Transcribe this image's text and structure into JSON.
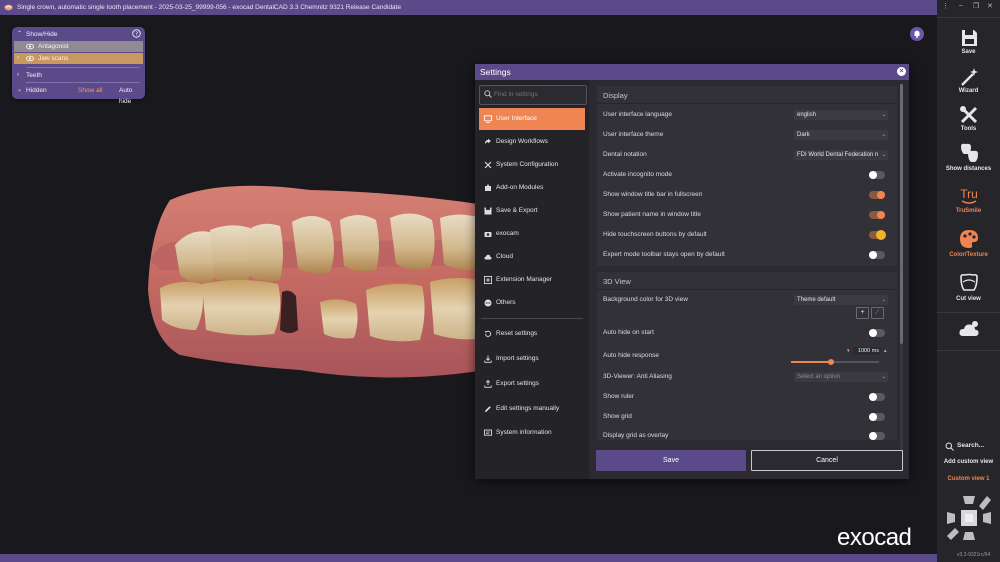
{
  "window": {
    "title": "Single crown, automatic single tooth placement - 2025-03-25_99999-056 - exocad DentalCAD 3.3 Chemnitz 9321 Release Candidate"
  },
  "show_hide": {
    "header": "Show/Hide",
    "items": [
      {
        "label": "Antagonist"
      },
      {
        "label": "Jaw scans"
      }
    ],
    "teeth_label": "Teeth",
    "hidden_label": "Hidden",
    "show_all_label": "Show all",
    "auto_hide_label": "Auto hide"
  },
  "settings": {
    "title": "Settings",
    "search_placeholder": "Find in settings",
    "nav": [
      {
        "label": "User Interface",
        "icon": "monitor-icon",
        "active": true
      },
      {
        "label": "Design Workflows",
        "icon": "workflow-icon"
      },
      {
        "label": "System Configuration",
        "icon": "wrench-icon"
      },
      {
        "label": "Add-on Modules",
        "icon": "puzzle-icon"
      },
      {
        "label": "Save & Export",
        "icon": "floppy-icon"
      },
      {
        "label": "exocam",
        "icon": "camera-icon"
      },
      {
        "label": "Cloud",
        "icon": "cloud-icon"
      },
      {
        "label": "Extension Manager",
        "icon": "extension-icon"
      },
      {
        "label": "Others",
        "icon": "dots-icon"
      }
    ],
    "nav_actions": [
      {
        "label": "Reset settings",
        "icon": "reset-icon"
      },
      {
        "label": "Import settings",
        "icon": "import-icon"
      },
      {
        "label": "Export settings",
        "icon": "export-icon"
      },
      {
        "label": "Edit settings manually",
        "icon": "edit-icon"
      },
      {
        "label": "System information",
        "icon": "info-icon"
      }
    ],
    "display": {
      "title": "Display",
      "language_label": "User interface language",
      "language_value": "english",
      "theme_label": "User interface theme",
      "theme_value": "Dark",
      "notation_label": "Dental notation",
      "notation_value": "FDI World Dental Federation n",
      "incognito_label": "Activate incognito mode",
      "incognito_on": false,
      "titlebar_label": "Show window title bar in fullscreen",
      "titlebar_on": true,
      "patient_label": "Show patient name in window title",
      "patient_on": true,
      "touch_label": "Hide touchscreen buttons by default",
      "touch_on": true,
      "expert_label": "Expert mode toolbar stays open by default",
      "expert_on": false
    },
    "view3d": {
      "title": "3D View",
      "bg_label": "Background color for 3D view",
      "bg_value": "Theme default",
      "autohide_label": "Auto hide on start",
      "autohide_on": false,
      "response_label": "Auto hide response",
      "response_value": "1000 ms",
      "response_fraction": 0.45,
      "aa_label": "3D-Viewer: Anti Aliasing",
      "aa_placeholder": "Select an option",
      "ruler_label": "Show ruler",
      "ruler_on": false,
      "grid_label": "Show grid",
      "grid_on": false,
      "overlay_label": "Display grid as overlay",
      "overlay_on": false
    },
    "save_label": "Save",
    "cancel_label": "Cancel"
  },
  "toolbar": {
    "tools": [
      {
        "label": "Save",
        "icon": "floppy-icon"
      },
      {
        "label": "Wizard",
        "icon": "wand-icon"
      },
      {
        "label": "Tools",
        "icon": "tools-icon"
      },
      {
        "label": "Show distances",
        "icon": "distance-icon"
      },
      {
        "label": "TruSmile",
        "icon": "trusmile-icon"
      },
      {
        "label": "Color/Texture",
        "icon": "palette-icon"
      },
      {
        "label": "Cut view",
        "icon": "cut-icon"
      }
    ],
    "search_label": "Search...",
    "add_view_label": "Add custom view",
    "custom_view_label": "Custom view 1",
    "version": "v3.3-9321rc/64"
  },
  "logo": "exocad",
  "colors": {
    "accent": "#ef8553",
    "brand_purple": "#5b4a8a",
    "background": "#19181d"
  }
}
